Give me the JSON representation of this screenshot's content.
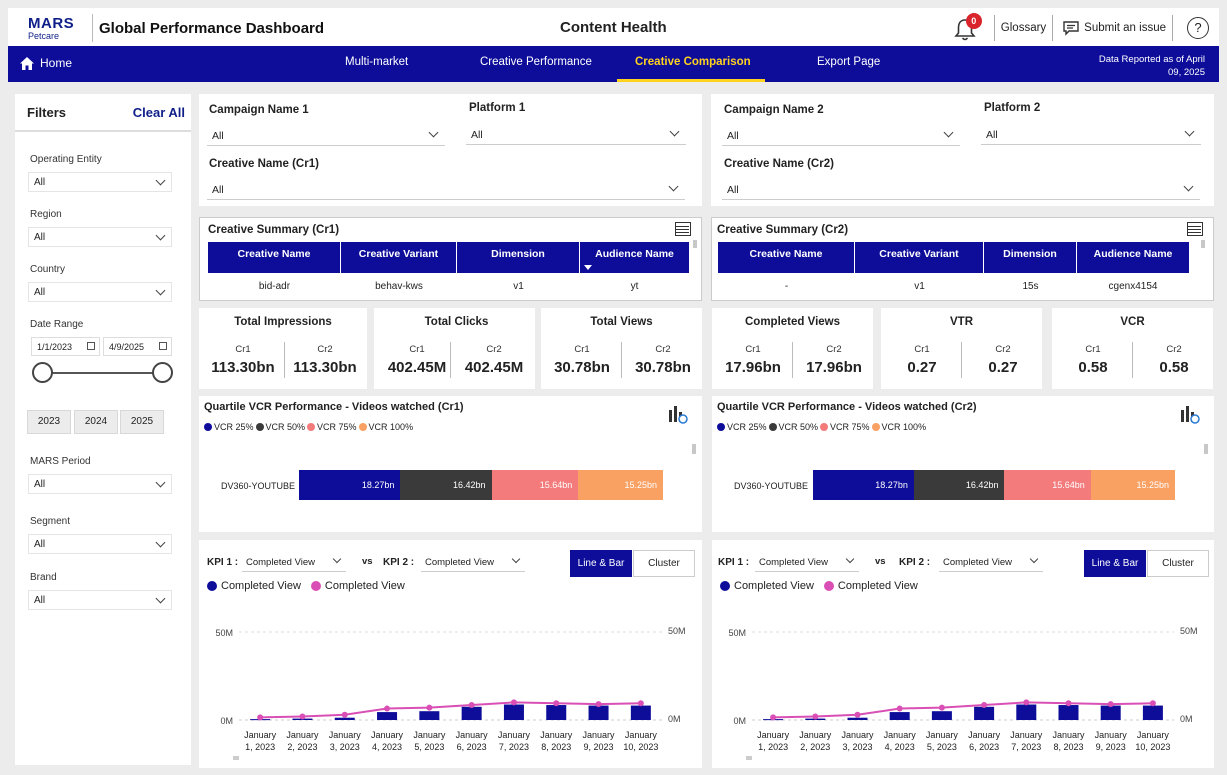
{
  "header": {
    "logo_top": "MARS",
    "logo_bottom": "Petcare",
    "app_title": "Global Performance Dashboard",
    "page_title": "Content Health",
    "notification_count": "0",
    "glossary": "Glossary",
    "submit_issue": "Submit an issue",
    "help": "?"
  },
  "nav": {
    "home": "Home",
    "tabs": [
      "Multi-market",
      "Creative Performance",
      "Creative Comparison",
      "Export Page"
    ],
    "active_tab": "Creative Comparison",
    "reported_line1": "Data Reported as of April",
    "reported_line2": "09, 2025"
  },
  "filters": {
    "title": "Filters",
    "clear_all": "Clear All",
    "operating_entity": {
      "label": "Operating Entity",
      "value": "All"
    },
    "region": {
      "label": "Region",
      "value": "All"
    },
    "country": {
      "label": "Country",
      "value": "All"
    },
    "date_range": {
      "label": "Date Range",
      "start": "1/1/2023",
      "end": "4/9/2025"
    },
    "years": [
      "2023",
      "2024",
      "2025"
    ],
    "mars_period": {
      "label": "MARS Period",
      "value": "All"
    },
    "segment": {
      "label": "Segment",
      "value": "All"
    },
    "brand": {
      "label": "Brand",
      "value": "All"
    }
  },
  "sel1": {
    "campaign_label": "Campaign Name 1",
    "campaign_value": "All",
    "platform_label": "Platform 1",
    "platform_value": "All",
    "creative_label": "Creative Name (Cr1)",
    "creative_value": "All"
  },
  "sel2": {
    "campaign_label": "Campaign Name 2",
    "campaign_value": "All",
    "platform_label": "Platform 2",
    "platform_value": "All",
    "creative_label": "Creative Name (Cr2)",
    "creative_value": "All"
  },
  "summary1": {
    "title": "Creative Summary (Cr1)",
    "columns": [
      "Creative Name",
      "Creative Variant",
      "Dimension",
      "Audience Name"
    ],
    "row": [
      "bid-adr",
      "behav-kws",
      "v1",
      "yt"
    ]
  },
  "summary2": {
    "title": "Creative Summary (Cr2)",
    "columns": [
      "Creative Name",
      "Creative Variant",
      "Dimension",
      "Audience Name"
    ],
    "row": [
      "-",
      "v1",
      "15s",
      "cgenx4154"
    ]
  },
  "kpis": [
    {
      "title": "Total Impressions",
      "cr1": "113.30bn",
      "cr2": "113.30bn"
    },
    {
      "title": "Total Clicks",
      "cr1": "402.45M",
      "cr2": "402.45M"
    },
    {
      "title": "Total Views",
      "cr1": "30.78bn",
      "cr2": "30.78bn"
    },
    {
      "title": "Completed Views",
      "cr1": "17.96bn",
      "cr2": "17.96bn"
    },
    {
      "title": "VTR",
      "cr1": "0.27",
      "cr2": "0.27"
    },
    {
      "title": "VCR",
      "cr1": "0.58",
      "cr2": "0.58"
    }
  ],
  "kpi_labels": {
    "cr1": "Cr1",
    "cr2": "Cr2"
  },
  "quartile": {
    "title1": "Quartile VCR Performance - Videos watched (Cr1)",
    "title2": "Quartile VCR Performance - Videos watched (Cr2)",
    "legend": [
      "VCR 25%",
      "VCR 50%",
      "VCR 75%",
      "VCR 100%"
    ],
    "colors": [
      "#0d0d9a",
      "#3a3a3a",
      "#f37b7b",
      "#f9a063"
    ]
  },
  "trend_controls": {
    "kpi1_label": "KPI 1 :",
    "kpi1_value": "Completed View",
    "vs": "vs",
    "kpi2_label": "KPI 2 :",
    "kpi2_value": "Completed View",
    "toggle_on": "Line & Bar",
    "toggle_off": "Cluster",
    "legend_bar": "Completed View",
    "legend_line": "Completed View",
    "bar_color": "#0d0d9a",
    "line_color": "#d94fb5"
  },
  "chart_data": [
    {
      "type": "bar",
      "title": "Quartile VCR Performance - Videos watched (Cr1)",
      "categories": [
        "DV360-YOUTUBE"
      ],
      "series": [
        {
          "name": "VCR 25%",
          "values": [
            18.27
          ],
          "label": "18.27bn"
        },
        {
          "name": "VCR 50%",
          "values": [
            16.42
          ],
          "label": "16.42bn"
        },
        {
          "name": "VCR 75%",
          "values": [
            15.64
          ],
          "label": "15.64bn"
        },
        {
          "name": "VCR 100%",
          "values": [
            15.25
          ],
          "label": "15.25bn"
        }
      ],
      "orientation": "horizontal-stacked"
    },
    {
      "type": "bar",
      "title": "Quartile VCR Performance - Videos watched (Cr2)",
      "categories": [
        "DV360-YOUTUBE"
      ],
      "series": [
        {
          "name": "VCR 25%",
          "values": [
            18.27
          ],
          "label": "18.27bn"
        },
        {
          "name": "VCR 50%",
          "values": [
            16.42
          ],
          "label": "16.42bn"
        },
        {
          "name": "VCR 75%",
          "values": [
            15.64
          ],
          "label": "15.64bn"
        },
        {
          "name": "VCR 100%",
          "values": [
            15.25
          ],
          "label": "15.25bn"
        }
      ],
      "orientation": "horizontal-stacked"
    },
    {
      "type": "bar",
      "categories_line1": [
        "January",
        "January",
        "January",
        "January",
        "January",
        "January",
        "January",
        "January",
        "January",
        "January"
      ],
      "categories_line2": [
        "1, 2023",
        "2, 2023",
        "3, 2023",
        "4, 2023",
        "5, 2023",
        "6, 2023",
        "7, 2023",
        "8, 2023",
        "9, 2023",
        "10, 2023"
      ],
      "ylim": [
        0,
        50
      ],
      "y_ticks_left": [
        "50M",
        "0M"
      ],
      "y_ticks_right": [
        "50M",
        "0M"
      ],
      "series": [
        {
          "name": "Completed View",
          "type": "bar",
          "values": [
            0.5,
            0.8,
            1.3,
            4.5,
            5.0,
            7.5,
            8.8,
            8.5,
            8.2,
            8.2
          ]
        },
        {
          "name": "Completed View",
          "type": "line",
          "values": [
            1.5,
            2.0,
            3.0,
            6.5,
            7.0,
            8.5,
            10.0,
            9.5,
            9.0,
            9.5
          ]
        }
      ]
    },
    {
      "type": "bar",
      "categories_line1": [
        "January",
        "January",
        "January",
        "January",
        "January",
        "January",
        "January",
        "January",
        "January",
        "January"
      ],
      "categories_line2": [
        "1, 2023",
        "2, 2023",
        "3, 2023",
        "4, 2023",
        "5, 2023",
        "6, 2023",
        "7, 2023",
        "8, 2023",
        "9, 2023",
        "10, 2023"
      ],
      "ylim": [
        0,
        50
      ],
      "y_ticks_left": [
        "50M",
        "0M"
      ],
      "y_ticks_right": [
        "50M",
        "0M"
      ],
      "series": [
        {
          "name": "Completed View",
          "type": "bar",
          "values": [
            0.5,
            0.8,
            1.3,
            4.5,
            5.0,
            7.5,
            8.8,
            8.5,
            8.2,
            8.2
          ]
        },
        {
          "name": "Completed View",
          "type": "line",
          "values": [
            1.5,
            2.0,
            3.0,
            6.5,
            7.0,
            8.5,
            10.0,
            9.5,
            9.0,
            9.5
          ]
        }
      ]
    }
  ]
}
